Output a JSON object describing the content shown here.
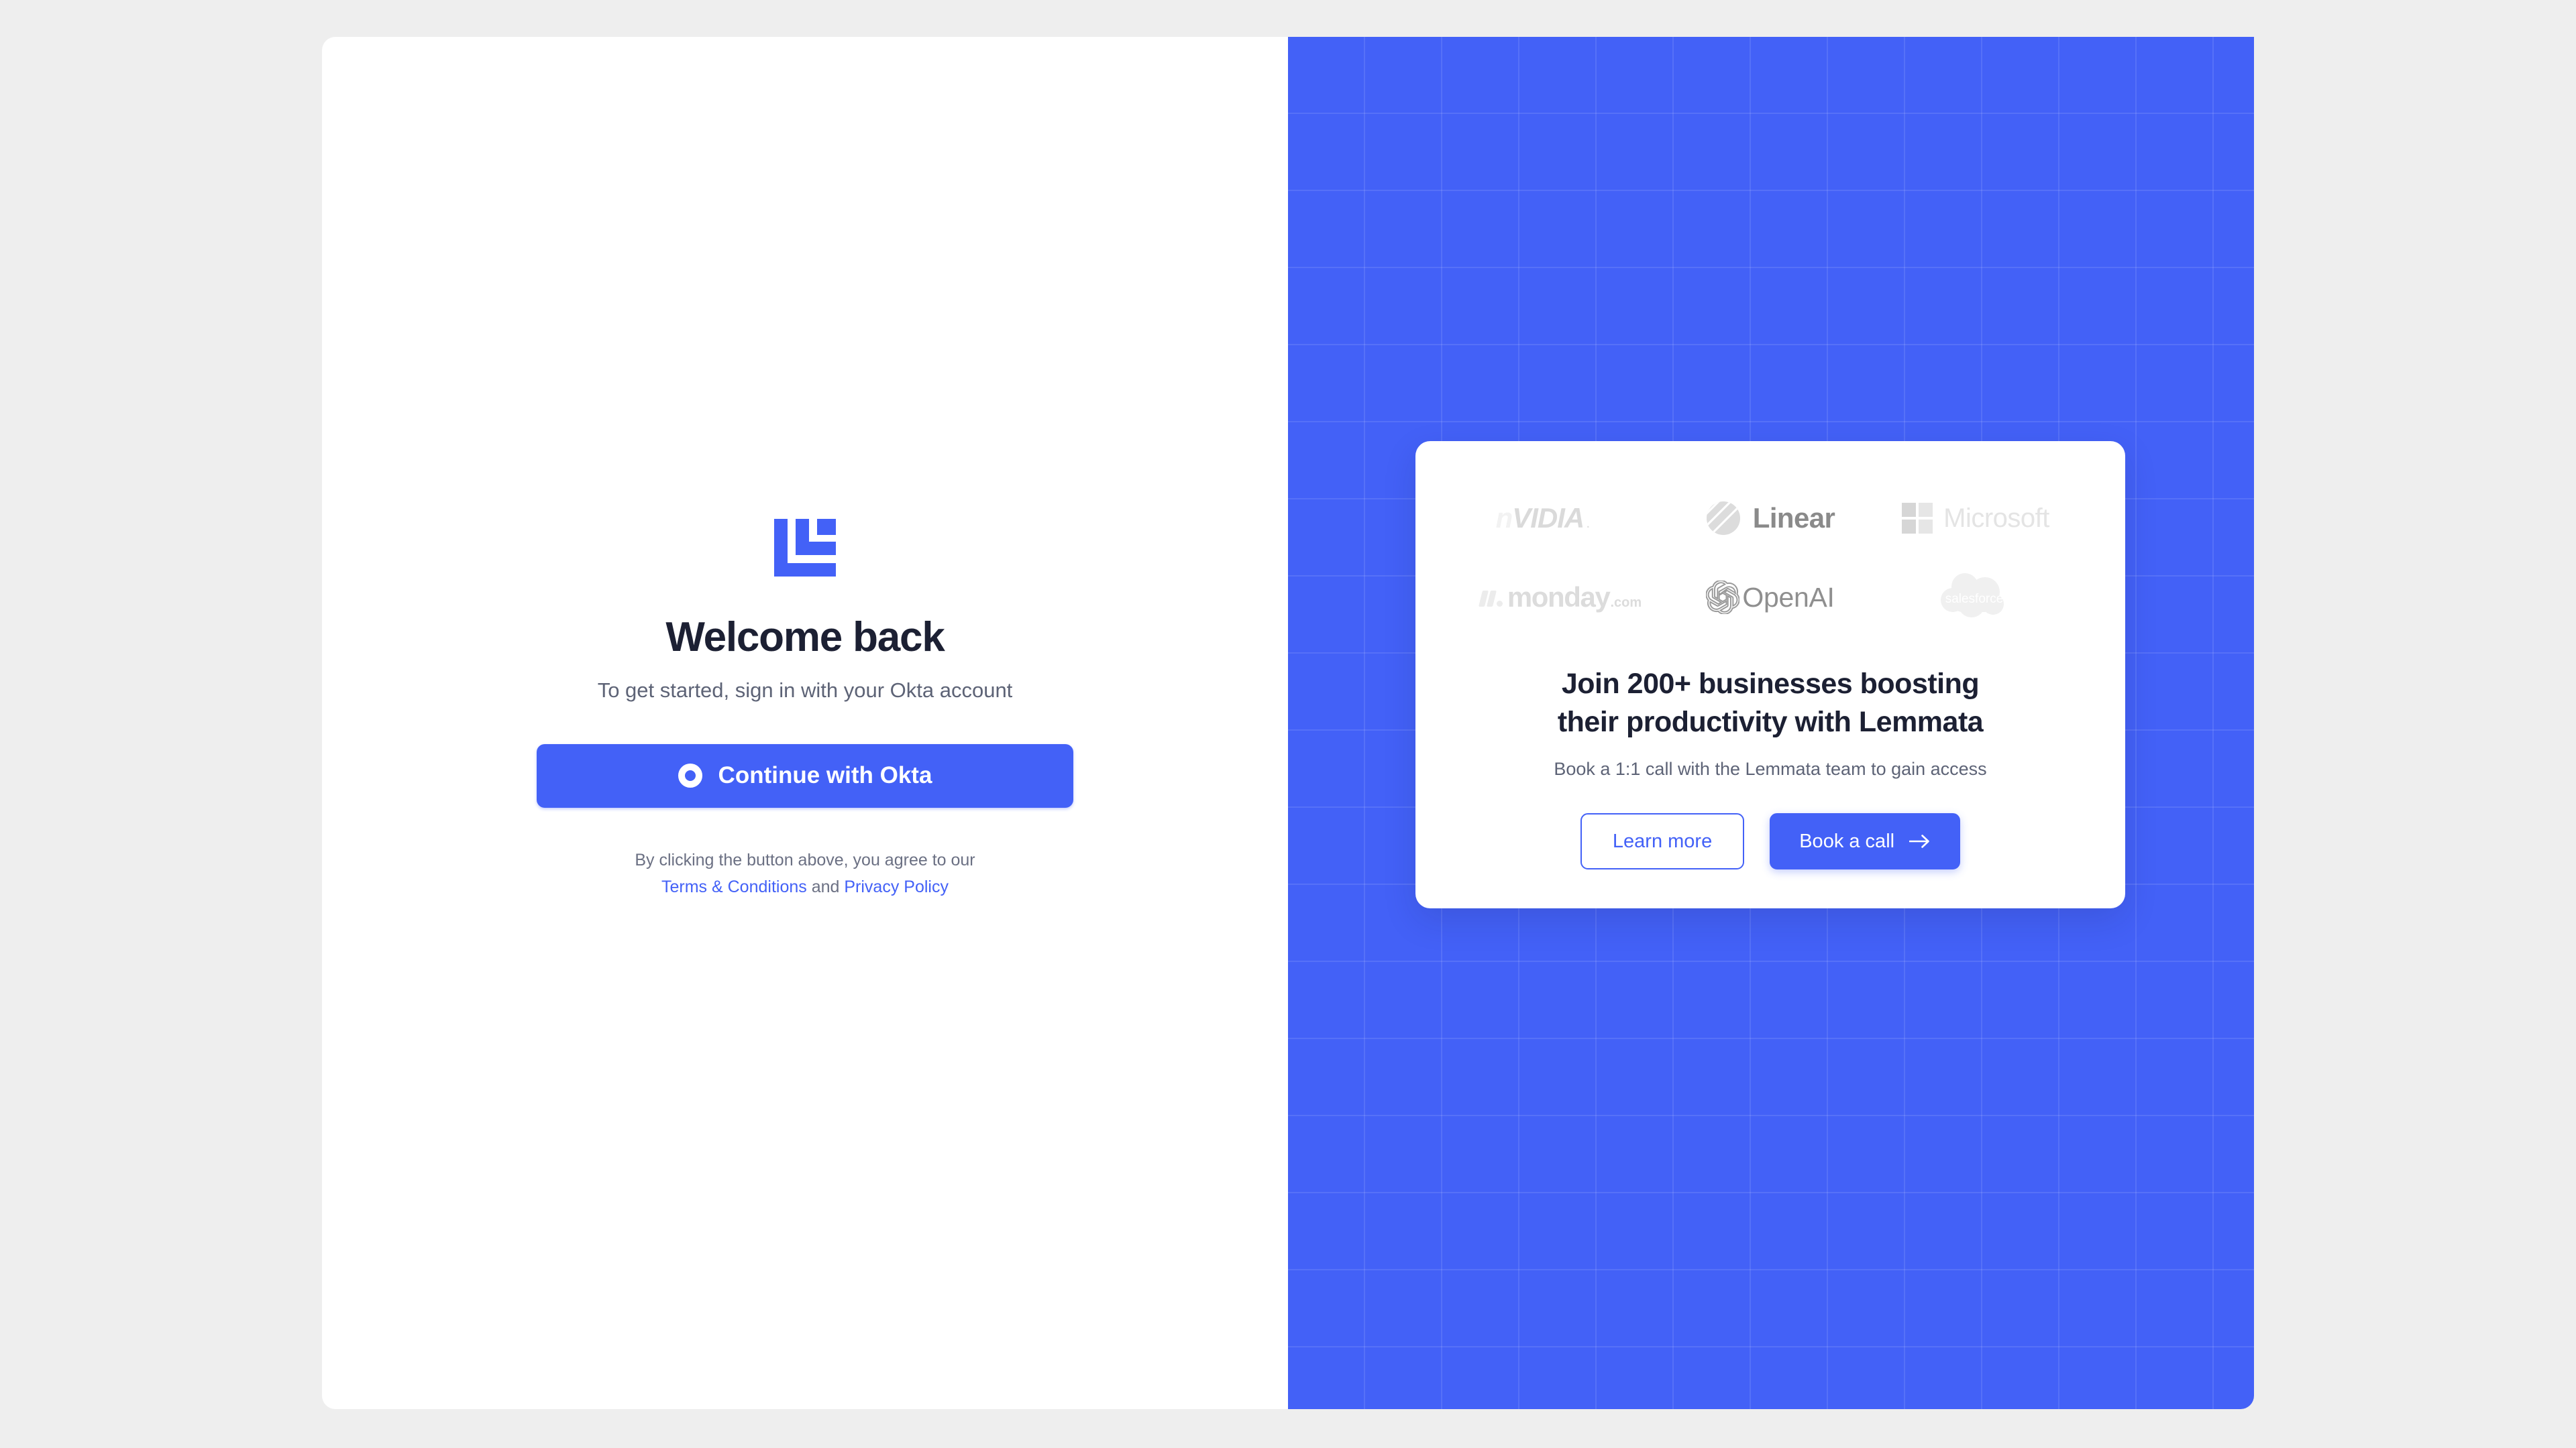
{
  "colors": {
    "accent": "#4361f7",
    "page_background": "#eeeeee",
    "panel_background": "#ffffff",
    "heading_text": "#1c2033",
    "muted_text": "#5d6376"
  },
  "auth": {
    "logo_name": "lemmata-logo",
    "title": "Welcome back",
    "subtitle": "To get started, sign in with your Okta account",
    "okta_button": {
      "label": "Continue with Okta",
      "icon": "okta-ring-icon"
    },
    "legal": {
      "prefix": "By clicking the button above, you agree to our",
      "terms_link": "Terms & Conditions",
      "conjunction": "and",
      "privacy_link": "Privacy Policy"
    }
  },
  "promo": {
    "logo_rows": [
      [
        {
          "name": "nvidia",
          "text": "nVIDIA",
          "lead": "n",
          "rest": "VIDIA",
          "mark": "."
        },
        {
          "name": "linear",
          "text": "Linear"
        },
        {
          "name": "microsoft",
          "text": "Microsoft"
        }
      ],
      [
        {
          "name": "monday",
          "text": "monday",
          "suffix": ".com"
        },
        {
          "name": "openai",
          "text": "OpenAI"
        },
        {
          "name": "salesforce",
          "text": "salesforce"
        }
      ]
    ],
    "heading_line1": "Join 200+ businesses boosting",
    "heading_line2": "their productivity with Lemmata",
    "subtitle": "Book a 1:1 call with the Lemmata team to gain access",
    "learn_more_label": "Learn more",
    "book_call_label": "Book a call",
    "book_call_icon": "arrow-right-icon"
  }
}
